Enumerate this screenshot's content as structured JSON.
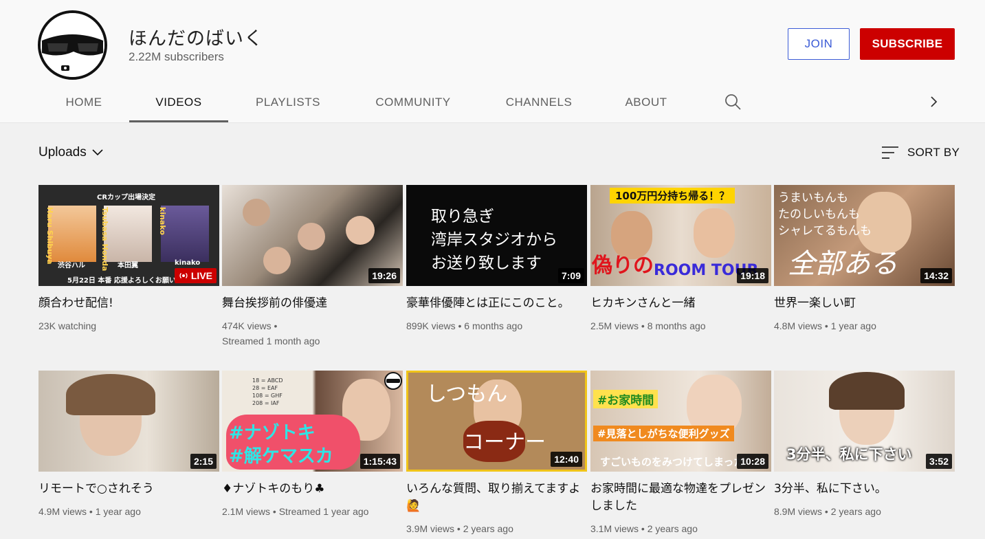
{
  "channel": {
    "name": "ほんだのばいく",
    "subscribers": "2.22M subscribers",
    "join_label": "JOIN",
    "subscribe_label": "SUBSCRIBE"
  },
  "tabs": [
    "HOME",
    "VIDEOS",
    "PLAYLISTS",
    "COMMUNITY",
    "CHANNELS",
    "ABOUT"
  ],
  "active_tab": "VIDEOS",
  "filter": {
    "label": "Uploads",
    "sort_label": "SORT BY"
  },
  "videos": [
    {
      "title": "顔合わせ配信!",
      "meta1": "23K watching",
      "meta2": "",
      "badge": "LIVE",
      "thumb_text": {
        "header": "CRカップ出場決定",
        "names": [
          "渋谷ハル",
          "本田翼",
          "kinako"
        ],
        "side_names": [
          "Haru Shibuya",
          "Tsubasa Honda",
          "kinako"
        ],
        "footer": "5月22日 本番 応援よろしくお願いし"
      }
    },
    {
      "title": "舞台挨拶前の俳優達",
      "meta1": "474K views",
      "meta2": "Streamed 1 month ago",
      "badge": "19:26"
    },
    {
      "title": "豪華俳優陣とは正にこのこと。",
      "meta1": "899K views",
      "meta2": "6 months ago",
      "badge": "7:09",
      "thumb_text": {
        "lines": [
          "取り急ぎ",
          "湾岸スタジオから",
          "お送り致します"
        ]
      }
    },
    {
      "title": "ヒカキンさんと一緒",
      "meta1": "2.5M views",
      "meta2": "8 months ago",
      "badge": "19:18",
      "thumb_text": {
        "top": "100万円分持ち帰る！？",
        "left": "偽りの",
        "right": "ROOM TOUR"
      }
    },
    {
      "title": "世界一楽しい町",
      "meta1": "4.8M views",
      "meta2": "1 year ago",
      "badge": "14:32",
      "thumb_text": {
        "lines": [
          "うまいもんも",
          "たのしいもんも",
          "シャレてるもんも"
        ],
        "script": "全部ある"
      }
    },
    {
      "title": "リモートで○されそう",
      "meta1": "4.9M views",
      "meta2": "1 year ago",
      "badge": "2:15"
    },
    {
      "title": "♦ナゾトキのもり♣",
      "meta1": "2.1M views",
      "meta2": "Streamed 1 year ago",
      "badge": "1:15:43",
      "thumb_text": {
        "lines": [
          "#ナゾトキ",
          "#解ケマスカ"
        ],
        "puzzle": [
          "18 = ABCD",
          "28 = EAF",
          "108 = GHF",
          "208 = IAF"
        ]
      }
    },
    {
      "title": "いろんな質問、取り揃えてますよ🙋",
      "meta1": "3.9M views",
      "meta2": "2 years ago",
      "badge": "12:40",
      "thumb_text": {
        "top": "しつもん",
        "bottom": "コーナー"
      }
    },
    {
      "title": "お家時間に最適な物達をプレゼンしました",
      "meta1": "3.1M views",
      "meta2": "2 years ago",
      "badge": "10:28",
      "thumb_text": {
        "tag1": "#お家時間",
        "tag2": "#見落としがちな便利グッズ",
        "bottom": "すごいものをみつけてしまった"
      }
    },
    {
      "title": "3分半、私に下さい。",
      "meta1": "8.9M views",
      "meta2": "2 years ago",
      "badge": "3:52",
      "thumb_text": {
        "caption": "3分半、私に下さい"
      }
    }
  ]
}
